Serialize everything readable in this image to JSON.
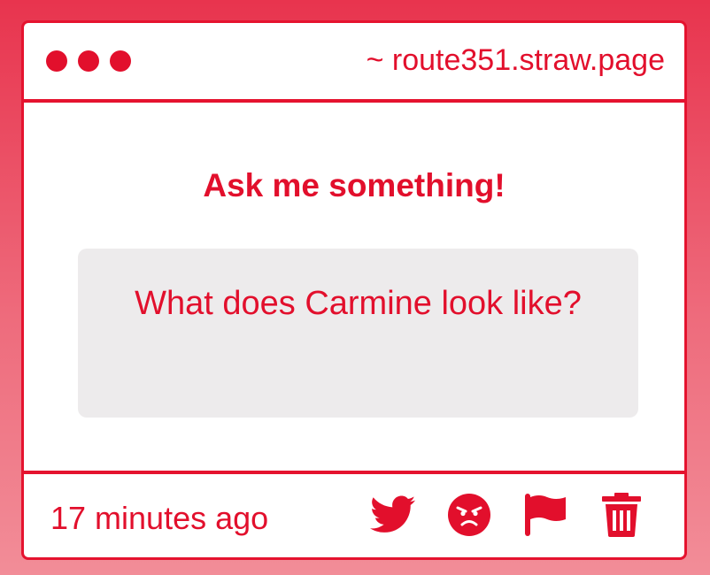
{
  "window": {
    "url": "~ route351.straw.page"
  },
  "main": {
    "heading": "Ask me something!",
    "question": "What does Carmine look like?"
  },
  "footer": {
    "timestamp": "17 minutes ago",
    "actions": [
      {
        "icon": "twitter-icon"
      },
      {
        "icon": "angry-face-icon"
      },
      {
        "icon": "flag-icon"
      },
      {
        "icon": "trash-icon"
      }
    ]
  },
  "colors": {
    "accent": "#e20f2c",
    "box": "#edebec",
    "background_top": "#e8344e",
    "background_bottom": "#f28d98"
  }
}
